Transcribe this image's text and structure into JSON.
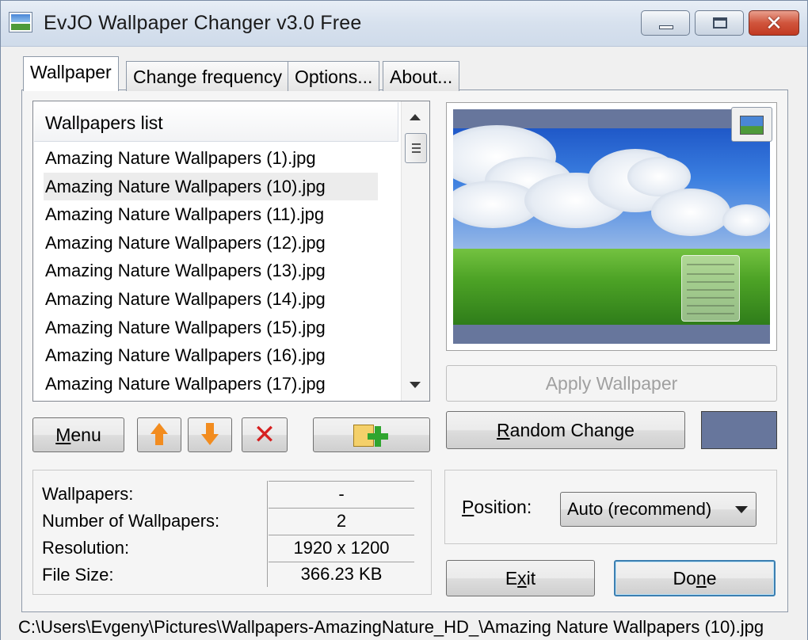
{
  "window": {
    "title": "EvJO Wallpaper Changer v3.0 Free"
  },
  "tabs": [
    {
      "label": "Wallpaper",
      "active": true
    },
    {
      "label": "Change frequency",
      "active": false
    },
    {
      "label": "Options...",
      "active": false
    },
    {
      "label": "About...",
      "active": false
    }
  ],
  "wallpapers_list": {
    "header": "Wallpapers list",
    "selected_index": 1,
    "items": [
      "Amazing Nature Wallpapers (1).jpg",
      "Amazing Nature Wallpapers (10).jpg",
      "Amazing Nature Wallpapers (11).jpg",
      "Amazing Nature Wallpapers (12).jpg",
      "Amazing Nature Wallpapers (13).jpg",
      "Amazing Nature Wallpapers (14).jpg",
      "Amazing Nature Wallpapers (15).jpg",
      "Amazing Nature Wallpapers (16).jpg",
      "Amazing Nature Wallpapers (17).jpg"
    ]
  },
  "list_buttons": {
    "menu_pre": "",
    "menu_mnemonic": "M",
    "menu_post": "enu",
    "move_up_icon": "arrow-up-icon",
    "move_down_icon": "arrow-down-icon",
    "delete_icon": "delete-icon",
    "add_icon": "add-folder-icon"
  },
  "preview": {
    "toggle_icon": "picture-icon",
    "background_color": "#67769c"
  },
  "actions": {
    "apply_wallpaper": "Apply Wallpaper",
    "random_change_mnemonic": "R",
    "random_change_rest": "andom Change",
    "exit_pre": "E",
    "exit_mnemonic": "x",
    "exit_post": "it",
    "done_pre": "Do",
    "done_mnemonic": "n",
    "done_post": "e"
  },
  "info": {
    "rows": [
      {
        "label": "Wallpapers:",
        "value": "-"
      },
      {
        "label": "Number of Wallpapers:",
        "value": "2"
      },
      {
        "label": "Resolution:",
        "value": "1920 x 1200"
      },
      {
        "label": "File Size:",
        "value": "366.23 KB"
      }
    ]
  },
  "position": {
    "label_mnemonic": "P",
    "label_rest": "osition:",
    "selected": "Auto (recommend)"
  },
  "status": {
    "path": "C:\\Users\\Evgeny\\Pictures\\Wallpapers-AmazingNature_HD_\\Amazing Nature Wallpapers (10).jpg"
  }
}
